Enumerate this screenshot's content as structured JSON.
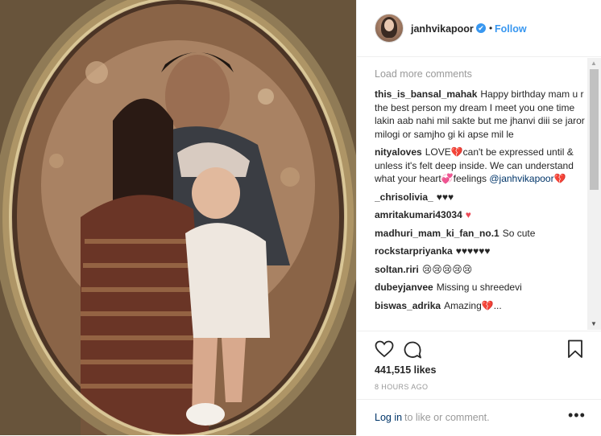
{
  "header": {
    "username": "janhvikapoor",
    "verified_mark": "✔",
    "separator": "•",
    "follow_label": "Follow"
  },
  "comments_section": {
    "load_more_label": "Load more comments",
    "items": [
      {
        "user": "this_is_bansal_mahak",
        "text": "Happy birthday mam u r the best person my dream I meet you one time lakin aab nahi mil sakte but me jhanvi diii se jaror milogi or samjho gi ki apse mil le"
      },
      {
        "user": "nityaloves",
        "text": "LOVE💔can't be expressed until & unless it's felt deep inside. We can understand what your heart💞feelings",
        "mention": "@janhvikapoor",
        "suffix": "💔"
      },
      {
        "user": "_chrisolivia_",
        "text": "♥♥♥"
      },
      {
        "user": "amritakumari43034",
        "text": "♥"
      },
      {
        "user": "madhuri_mam_ki_fan_no.1",
        "text": "So cute"
      },
      {
        "user": "rockstarpriyanka",
        "text": "♥♥♥♥♥♥"
      },
      {
        "user": "soltan.riri",
        "text": "😢😢😢😢😢"
      },
      {
        "user": "dubeyjanvee",
        "text": "Missing u shreedevi"
      },
      {
        "user": "biswas_adrika",
        "text": "Amazing💔..."
      }
    ]
  },
  "icons": {
    "like": "heart-icon",
    "comment": "comment-icon",
    "save": "bookmark-icon",
    "more": "more-options-icon"
  },
  "post_stats": {
    "likes": "441,515 likes",
    "time": "8 HOURS AGO"
  },
  "footer": {
    "login_label": "Log in",
    "login_rest": "to like or comment.",
    "more_label": "•••"
  },
  "colors": {
    "accent": "#3897f0",
    "link": "#003569",
    "muted": "#999999",
    "border": "#efefef",
    "heart_red": "#ed4956"
  }
}
